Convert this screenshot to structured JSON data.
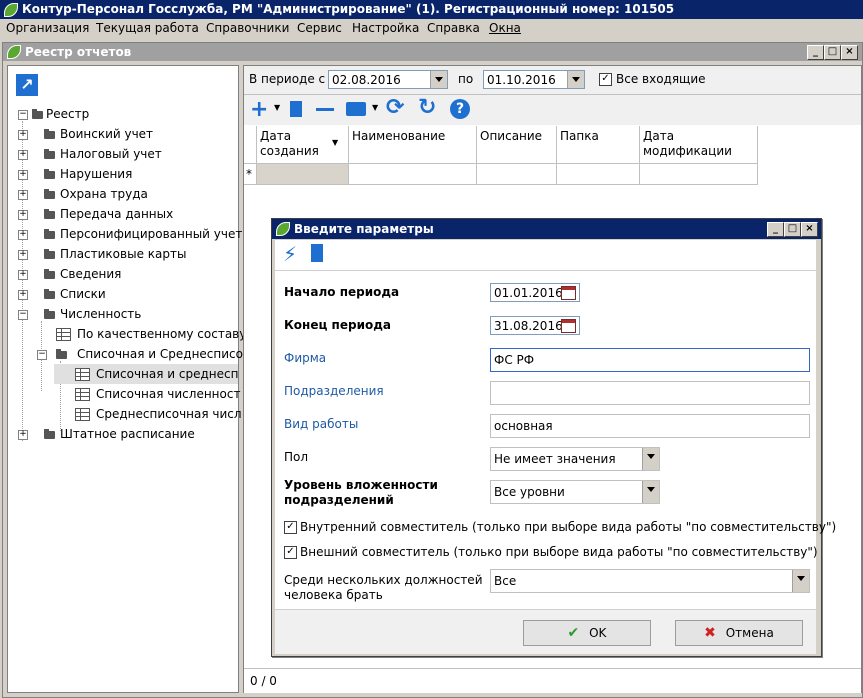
{
  "app": {
    "title": "Контур-Персонал Госслужба, РМ \"Администрирование\" (1). Регистрационный номер: 101505"
  },
  "menubar": [
    "Организация",
    "Текущая работа",
    "Справочники",
    "Сервис",
    "Настройка",
    "Справка",
    "Окна"
  ],
  "child_window": {
    "title": "Реестр отчетов"
  },
  "tree": {
    "root": "Реестр",
    "items": [
      "Воинский учет",
      "Налоговый учет",
      "Нарушения",
      "Охрана труда",
      "Передача данных",
      "Персонифицированный учет",
      "Пластиковые карты",
      "Сведения",
      "Списки",
      "Численность"
    ],
    "chislennost_children": {
      "item1": "По качественному составу",
      "group": "Списочная и Среднесписо",
      "group_children": [
        "Списочная и среднесп",
        "Списочная численност",
        "Среднесписочная числ"
      ]
    },
    "last": "Штатное расписание"
  },
  "filter": {
    "period_label": "В периоде с",
    "from_value": "02.08.2016",
    "to_label": "по",
    "to_value": "01.10.2016",
    "all_incoming_label": "Все входящие",
    "all_incoming_checked": true
  },
  "grid": {
    "columns": [
      "Дата\nсоздания",
      "Наименование",
      "Описание",
      "Папка",
      "Дата\nмодификации"
    ],
    "new_row_marker": "*"
  },
  "status": {
    "counter": "0 / 0"
  },
  "dialog": {
    "title": "Введите параметры",
    "fields": {
      "start_label": "Начало периода",
      "start_value": "01.01.2016",
      "end_label": "Конец периода",
      "end_value": "31.08.2016",
      "firm_label": "Фирма",
      "firm_value": "ФС РФ",
      "dept_label": "Подразделения",
      "dept_value": "",
      "work_label": "Вид работы",
      "work_value": "основная",
      "gender_label": "Пол",
      "gender_value": "Не имеет значения",
      "level_label_1": "Уровень вложенности",
      "level_label_2": "подразделений",
      "level_value": "Все уровни",
      "internal_label": "Внутренний совместитель (только при выборе вида работы \"по совместительству\")",
      "internal_checked": true,
      "external_label": "Внешний совместитель (только при выборе вида работы \"по совместительству\")",
      "external_checked": true,
      "among_label_1": "Среди нескольких должностей",
      "among_label_2": "человека брать",
      "among_value": "Все"
    },
    "ok_label": "OK",
    "cancel_label": "Отмена"
  },
  "colors": {
    "titlebar": "#0a246a",
    "accent_blue": "#1f6fd0",
    "ok_green": "#2e9a2e",
    "cancel_red": "#d02020"
  }
}
